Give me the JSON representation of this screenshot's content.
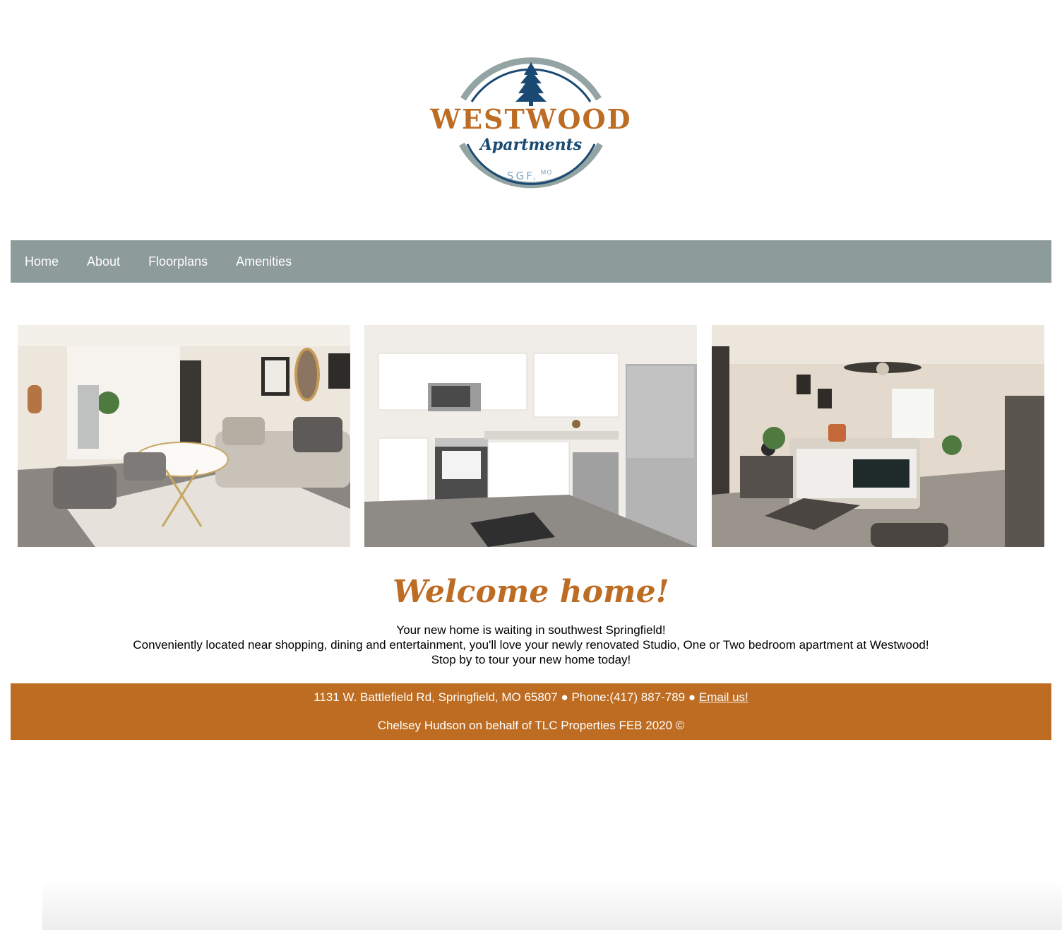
{
  "logo": {
    "name": "WESTWOOD",
    "script": "Apartments",
    "location": "SGF.",
    "state": "MO"
  },
  "nav": {
    "items": [
      {
        "label": "Home"
      },
      {
        "label": "About"
      },
      {
        "label": "Floorplans"
      },
      {
        "label": "Amenities"
      }
    ]
  },
  "gallery": {
    "photos": [
      {
        "name": "living-room-photo"
      },
      {
        "name": "kitchen-photo"
      },
      {
        "name": "bedroom-photo"
      }
    ]
  },
  "main": {
    "heading": "Welcome home!",
    "lines": [
      "Your new home is waiting in southwest Springfield!",
      "Conveniently located near shopping, dining and entertainment, you'll love your newly renovated Studio, One or Two bedroom apartment at Westwood!",
      "Stop by to tour your new home today!"
    ]
  },
  "footer": {
    "contact": "1131 W. Battlefield Rd, Springfield, MO 65807 ● Phone:(417) 887-789 ● ",
    "email_label": "Email us!",
    "credit": "Chelsey Hudson on behalf of TLC Properties FEB 2020 ©"
  },
  "colors": {
    "nav_bg": "#8d9b9a",
    "accent": "#bd6c21",
    "logo_navy": "#1a4a73",
    "logo_gray": "#94a3a3"
  }
}
